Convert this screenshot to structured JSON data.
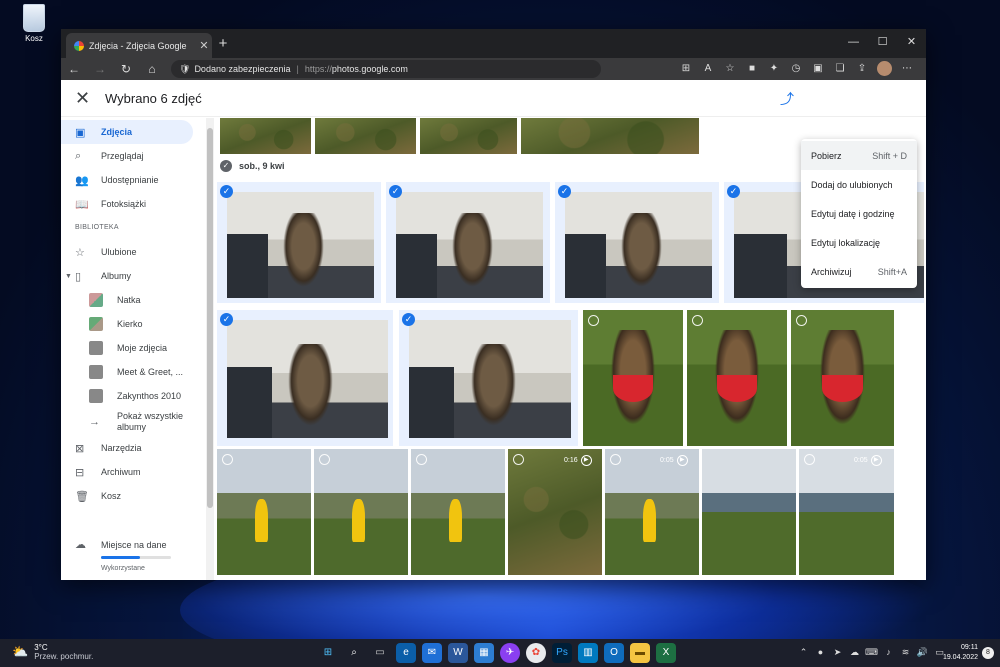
{
  "desktop": {
    "recycle_bin_label": "Kosz"
  },
  "browser": {
    "tab_title": "Zdjęcia - Zdjęcia Google",
    "tab_close": "✕",
    "new_tab": "+",
    "security_label": "Dodano zabezpieczenia",
    "url_protocol": "https://",
    "url_host": "photos.google.com"
  },
  "header": {
    "close_icon": "✕",
    "selection_title": "Wybrano 6 zdjęć"
  },
  "sidebar": {
    "items": [
      {
        "label": "Zdjęcia",
        "icon": "photo-icon"
      },
      {
        "label": "Przeglądaj",
        "icon": "search-icon"
      },
      {
        "label": "Udostępnianie",
        "icon": "people-icon"
      },
      {
        "label": "Fotoksiążki",
        "icon": "book-icon"
      }
    ],
    "library_label": "BIBLIOTEKA",
    "library_items": [
      {
        "label": "Ulubione",
        "icon": "star-icon"
      },
      {
        "label": "Albumy",
        "icon": "album-icon"
      }
    ],
    "albums": [
      {
        "label": "Natka"
      },
      {
        "label": "Kierko"
      },
      {
        "label": "Moje zdjęcia"
      },
      {
        "label": "Meet & Greet, ..."
      },
      {
        "label": "Zakynthos 2010"
      }
    ],
    "show_all_label": "Pokaż wszystkie albumy",
    "utility_items": [
      {
        "label": "Narzędzia",
        "icon": "tools-icon"
      },
      {
        "label": "Archiwum",
        "icon": "archive-icon"
      },
      {
        "label": "Kosz",
        "icon": "trash-icon"
      }
    ],
    "storage_label": "Miejsce na dane",
    "storage_used_label": "Wykorzystane",
    "storage_fraction": 0.55
  },
  "content": {
    "date_label": "sob., 9 kwi",
    "video_durations": [
      "0:16",
      "0:05",
      "0:05"
    ]
  },
  "menu": {
    "items": [
      {
        "label": "Pobierz",
        "shortcut": "Shift + D"
      },
      {
        "label": "Dodaj do ulubionych",
        "shortcut": ""
      },
      {
        "label": "Edytuj datę i godzinę",
        "shortcut": ""
      },
      {
        "label": "Edytuj lokalizację",
        "shortcut": ""
      },
      {
        "label": "Archiwizuj",
        "shortcut": "Shift+A"
      }
    ]
  },
  "taskbar": {
    "temperature": "3°C",
    "weather_desc": "Przew. pochmur.",
    "time": "09:11",
    "date": "19.04.2022",
    "notifications": "8"
  },
  "colors": {
    "accent": "#1a73e8",
    "selection_bg": "#e8f0fe"
  }
}
